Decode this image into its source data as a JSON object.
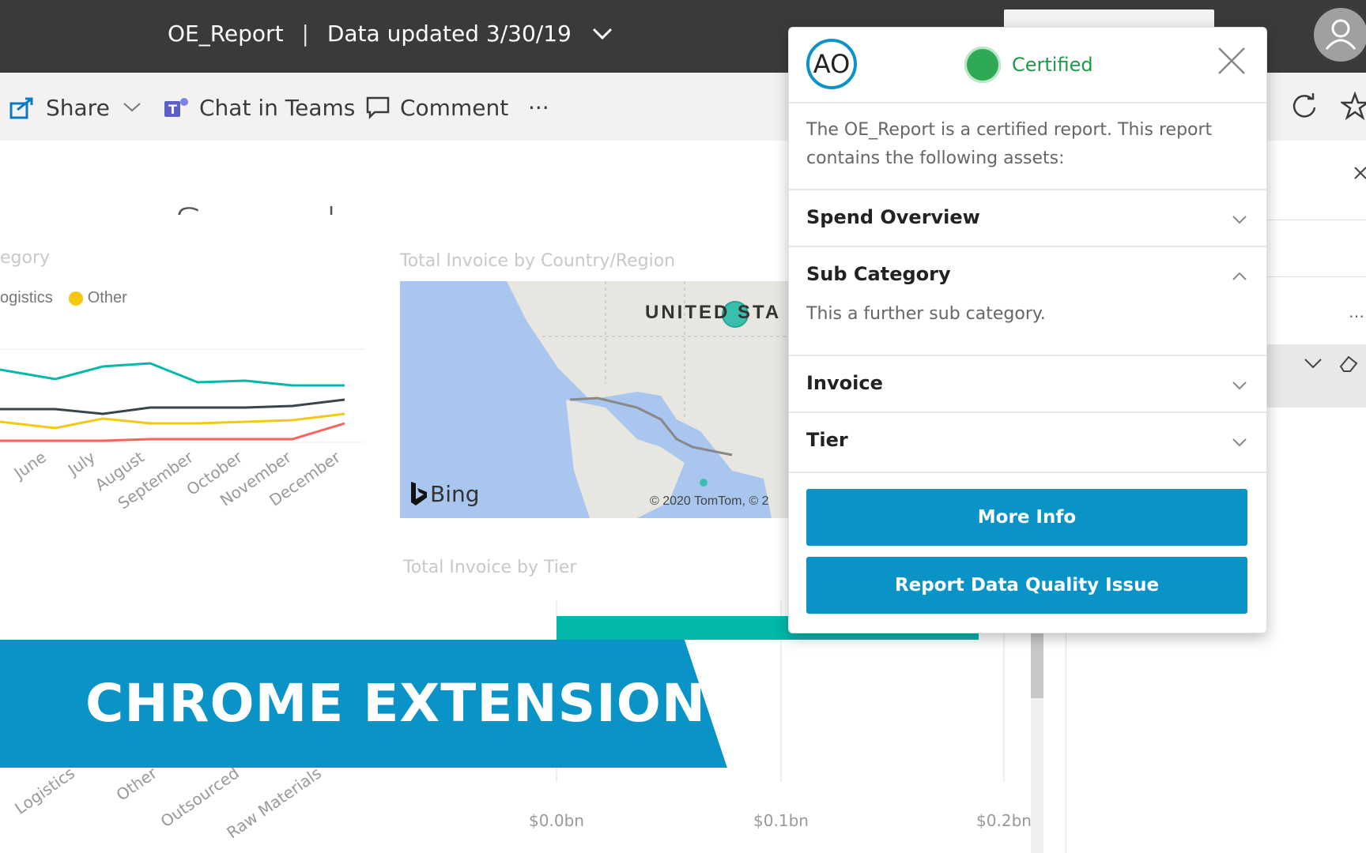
{
  "header": {
    "report_name": "OE_Report",
    "separator": "|",
    "data_updated": "Data updated 3/30/19"
  },
  "toolbar": {
    "share_label": "Share",
    "chat_label": "Chat in Teams",
    "comment_label": "Comment",
    "more_label": "···"
  },
  "report": {
    "page_title": "Spend Overview",
    "line_chart_title": "egory",
    "legend": {
      "item1": "ogistics",
      "item2": "Other"
    },
    "line_chart_months": [
      "June",
      "July",
      "August",
      "September",
      "October",
      "November",
      "December"
    ],
    "map_title": "Total Invoice by Country/Region",
    "map_country": "UNITED STA",
    "map_copyright": "© 2020 TomTom, © 2",
    "map_brand": "Bing",
    "tier_chart_title": "Total Invoice by Tier",
    "tier_axis_ticks": [
      "$0.0bn",
      "$0.1bn",
      "$0.2bn"
    ],
    "category_ticks": [
      "Logistics",
      "Other",
      "Outsourced",
      "Raw Materials"
    ]
  },
  "popup": {
    "avatar_initials": "AO",
    "certified_label": "Certified",
    "intro": "The OE_Report is a certified report. This report contains the following assets:",
    "sections": [
      {
        "title": "Spend Overview",
        "expanded": false
      },
      {
        "title": "Sub Category",
        "expanded": true,
        "description": "This a further sub category."
      },
      {
        "title": "Invoice",
        "expanded": false
      },
      {
        "title": "Tier",
        "expanded": false
      }
    ],
    "more_info_label": "More Info",
    "report_issue_label": "Report Data Quality Issue"
  },
  "banner": {
    "text": "CHROME EXTENSION"
  },
  "colors": {
    "topbar": "#3b3a39",
    "toolbar": "#f3f2f1",
    "accent_blue": "#0a93c7",
    "certified_green": "#2eaa55",
    "teal_series": "#01b8aa",
    "dark_series": "#374649",
    "yellow_series": "#f2c811",
    "red_series": "#fd625e"
  }
}
